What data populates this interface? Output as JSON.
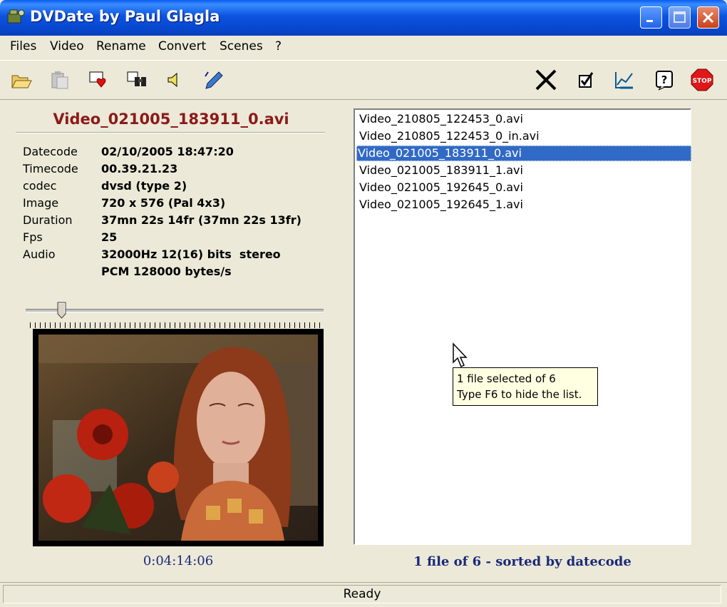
{
  "window": {
    "title": "DVDate by Paul Glagla"
  },
  "menu": [
    "Files",
    "Video",
    "Rename",
    "Convert",
    "Scenes",
    "?"
  ],
  "toolbar": {
    "left_icons": [
      "open-folder-icon",
      "paste-icon",
      "add-heart-icon",
      "find-icon",
      "speaker-icon",
      "edit-pen-icon"
    ],
    "right_icons": [
      "delete-x-icon",
      "check-icon",
      "chart-icon",
      "help-icon",
      "stop-icon"
    ]
  },
  "file_info": {
    "filename": "Video_021005_183911_0.avi",
    "rows": [
      {
        "label": "Datecode",
        "value": "02/10/2005 18:47:20"
      },
      {
        "label": "Timecode",
        "value": "00.39.21.23"
      },
      {
        "label": "codec",
        "value": "dvsd (type 2)"
      },
      {
        "label": "Image",
        "value": "720 x 576 (Pal 4x3)"
      },
      {
        "label": "Duration",
        "value": "37mn 22s 14fr (37mn 22s 13fr)"
      },
      {
        "label": "Fps",
        "value": "25"
      },
      {
        "label": "Audio",
        "value": "32000Hz 12(16) bits  stereo"
      },
      {
        "label": "",
        "value": "PCM 128000 bytes/s"
      }
    ]
  },
  "player": {
    "position_fraction": 0.12,
    "timecode": "0:04:14:06"
  },
  "file_list": {
    "items": [
      "Video_210805_122453_0.avi",
      "Video_210805_122453_0_in.avi",
      "Video_021005_183911_0.avi",
      "Video_021005_183911_1.avi",
      "Video_021005_192645_0.avi",
      "Video_021005_192645_1.avi"
    ],
    "selected_index": 2,
    "status": "1 file of 6 - sorted by datecode"
  },
  "tooltip": {
    "line1": "1 file selected of 6",
    "line2": "Type F6 to hide the list."
  },
  "statusbar": {
    "text": "Ready"
  },
  "colors": {
    "title_bar": "#0b53e0",
    "filename": "#8b1a1a",
    "selection": "#316ac5",
    "caption_blue": "#1a2a7a",
    "tooltip_bg": "#ffffe1"
  }
}
